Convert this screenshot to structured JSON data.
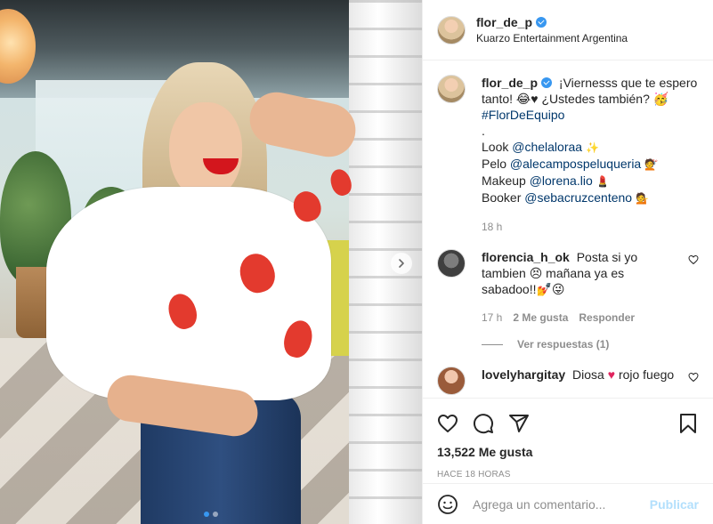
{
  "post": {
    "username": "flor_de_p",
    "location": "Kuarzo Entertainment Argentina"
  },
  "caption": {
    "username": "flor_de_p",
    "line1": "¡Viernesss que te espero tanto! 😂♥ ¿Ustedes también? 🥳",
    "hashtag": "#FlorDeEquipo",
    "separator": ".",
    "credits": [
      {
        "label": "Look",
        "handle": "@chelaloraa",
        "emoji": "✨"
      },
      {
        "label": "Pelo",
        "handle": "@alecampospeluqueria",
        "emoji": "💇"
      },
      {
        "label": "Makeup",
        "handle": "@lorena.lio",
        "emoji": "💄"
      },
      {
        "label": "Booker",
        "handle": "@sebacruzcenteno",
        "emoji": "💁"
      }
    ],
    "time": "18 h"
  },
  "comments": [
    {
      "username": "florencia_h_ok",
      "text": "Posta si yo tambien 😣 mañana ya es sabadoo!!💅😜",
      "time": "17 h",
      "likes": "2 Me gusta",
      "reply": "Responder",
      "view_replies": "Ver respuestas (1)"
    },
    {
      "username": "lovelyhargitay",
      "text_before": "Diosa",
      "heart": "♥",
      "text_after": "rojo fuego"
    }
  ],
  "likes": "13,522 Me gusta",
  "time_ago": "HACE 18 HORAS",
  "add_comment": {
    "placeholder": "Agrega un comentario...",
    "publish": "Publicar"
  },
  "carousel": {
    "slides": 2,
    "active": 0
  },
  "colors": {
    "link": "#00376b",
    "verified": "#3897f0",
    "publish": "#b2dffc",
    "muted": "#8e8e8e"
  },
  "icons": [
    "verified-badge-icon",
    "like-heart-icon",
    "comment-bubble-icon",
    "share-paper-plane-icon",
    "bookmark-icon",
    "emoji-smiley-icon",
    "carousel-next-icon"
  ]
}
